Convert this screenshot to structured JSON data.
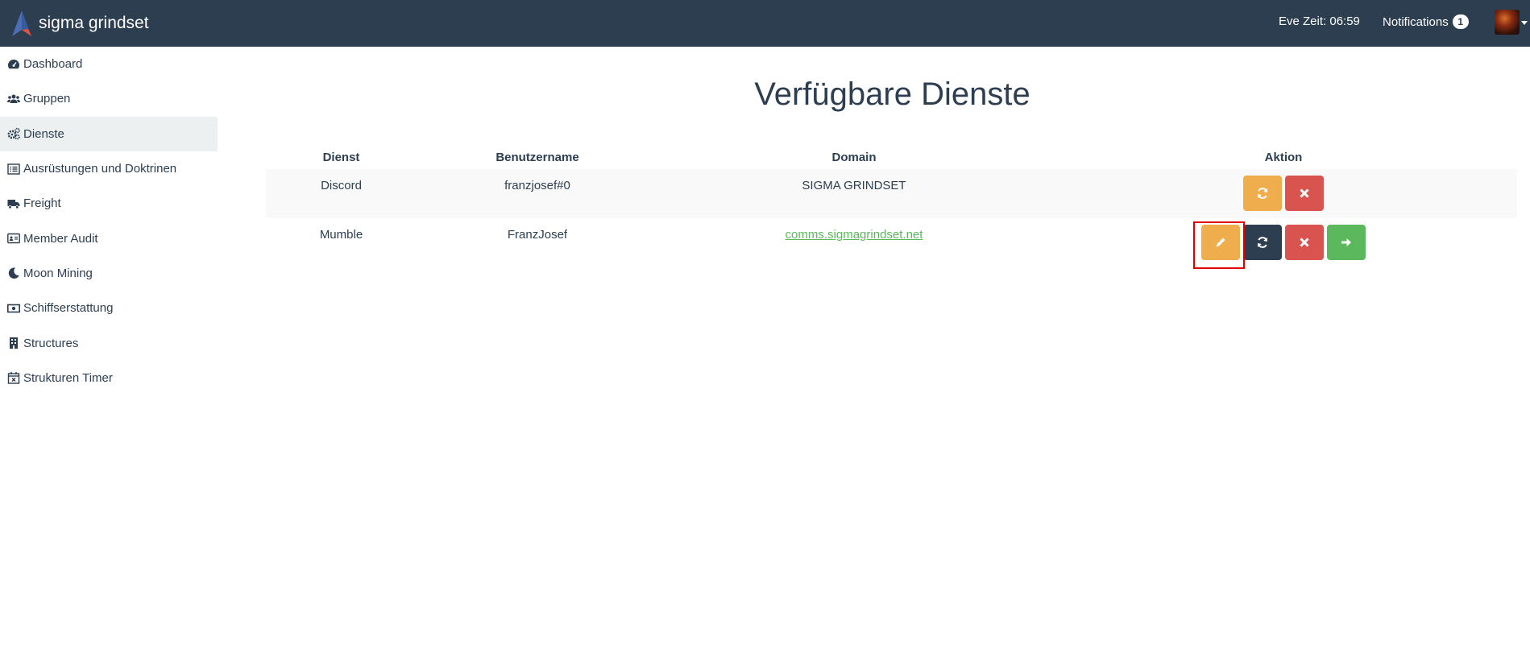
{
  "header": {
    "brand": "sigma grindset",
    "eve_time": "Eve Zeit: 06:59",
    "notifications_label": "Notifications",
    "notifications_count": "1"
  },
  "sidebar": {
    "items": [
      {
        "label": "Dashboard",
        "icon": "dashboard-icon"
      },
      {
        "label": "Gruppen",
        "icon": "users-icon"
      },
      {
        "label": "Dienste",
        "icon": "cogs-icon",
        "active": true
      },
      {
        "label": "Ausrüstungen und Doktrinen",
        "icon": "list-icon"
      },
      {
        "label": "Freight",
        "icon": "truck-icon"
      },
      {
        "label": "Member Audit",
        "icon": "id-card-icon"
      },
      {
        "label": "Moon Mining",
        "icon": "moon-icon"
      },
      {
        "label": "Schiffserstattung",
        "icon": "money-icon"
      },
      {
        "label": "Structures",
        "icon": "building-icon"
      },
      {
        "label": "Strukturen Timer",
        "icon": "calendar-x-icon"
      }
    ]
  },
  "main": {
    "title": "Verfügbare Dienste",
    "table": {
      "headers": [
        "Dienst",
        "Benutzername",
        "Domain",
        "Aktion"
      ],
      "rows": [
        {
          "service": "Discord",
          "username": "franzjosef#0",
          "domain": "SIGMA GRINDSET",
          "domain_is_link": false,
          "actions": [
            "refresh",
            "delete"
          ]
        },
        {
          "service": "Mumble",
          "username": "FranzJosef",
          "domain": "comms.sigmagrindset.net",
          "domain_is_link": true,
          "actions": [
            "edit",
            "refresh",
            "delete",
            "connect"
          ]
        }
      ]
    }
  },
  "colors": {
    "navbar": "#2c3e50",
    "warning": "#f0ad4e",
    "primary": "#2c3e50",
    "danger": "#d9534f",
    "success": "#5cb85c",
    "active_sidebar": "#ecf0f1",
    "highlight_box": "#e00000"
  }
}
